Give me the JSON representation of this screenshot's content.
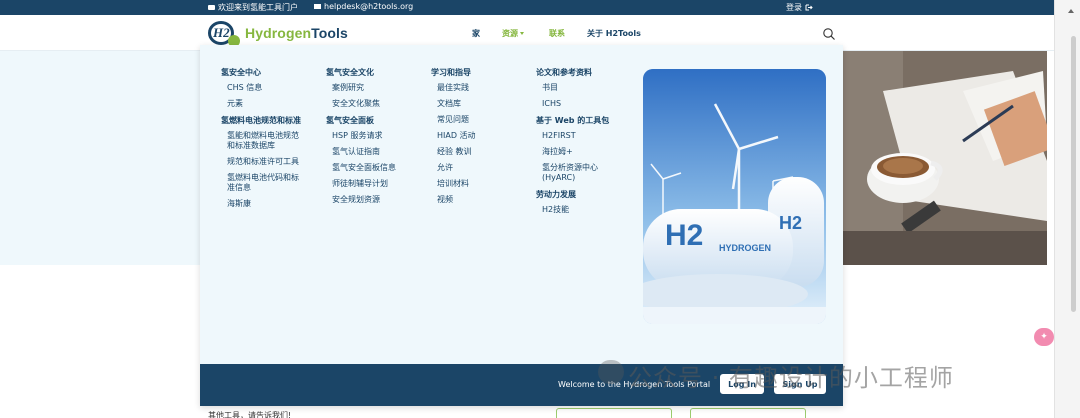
{
  "topbar": {
    "welcome": "欢迎来到氢能工具门户",
    "email": "helpdesk@h2tools.org",
    "login": "登录"
  },
  "header": {
    "logo_badge": "H2",
    "logo_part1": "Hydrogen",
    "logo_part2": "Tools",
    "nav": {
      "home": "家",
      "resources": "资源",
      "contact": "联系",
      "about": "关于 H2Tools"
    }
  },
  "mega_menu": {
    "col1": {
      "heading1": "氢安全中心",
      "links1": [
        "CHS 信息",
        "元素"
      ],
      "heading2": "氢燃料电池规范和标准",
      "links2": [
        "氢能和燃料电池规范和标准数据库",
        "规范和标准许可工具",
        "氢燃料电池代码和标准信息",
        "海斯康"
      ]
    },
    "col2": {
      "heading1": "氢气安全文化",
      "links1": [
        "案例研究",
        "安全文化聚焦"
      ],
      "heading2": "氢气安全面板",
      "links2": [
        "HSP 服务请求",
        "氢气认证指南",
        "氢气安全面板信息",
        "师徒制辅导计划",
        "安全规划资源"
      ]
    },
    "col3": {
      "heading1": "学习和指导",
      "links1": [
        "最佳实践",
        "文档库",
        "常见问题",
        "HIAD 活动",
        "经验 教训",
        "允许",
        "培训材料",
        "视频"
      ]
    },
    "col4": {
      "heading1": "论文和参考资料",
      "links1": [
        "书目",
        "ICHS"
      ],
      "heading2": "基于 Web 的工具包",
      "links2": [
        "H2FIRST",
        "海拉姆+",
        "氢分析资源中心(HyARC)"
      ],
      "heading3": "劳动力发展",
      "links3": [
        "H2技能"
      ]
    },
    "image_text": {
      "big": "H2",
      "small": "HYDROGEN"
    },
    "footer": {
      "welcome": "Welcome to the Hydrogen Tools Portal",
      "login": "Log In",
      "signup": "Sign Up"
    }
  },
  "below": {
    "text": "其他工具，请告诉我们!"
  },
  "watermark": "公众号 · 有趣设计的小工程师",
  "colors": {
    "navy": "#1b4567",
    "green": "#86b73f",
    "menu_bg": "#eff8fc"
  }
}
